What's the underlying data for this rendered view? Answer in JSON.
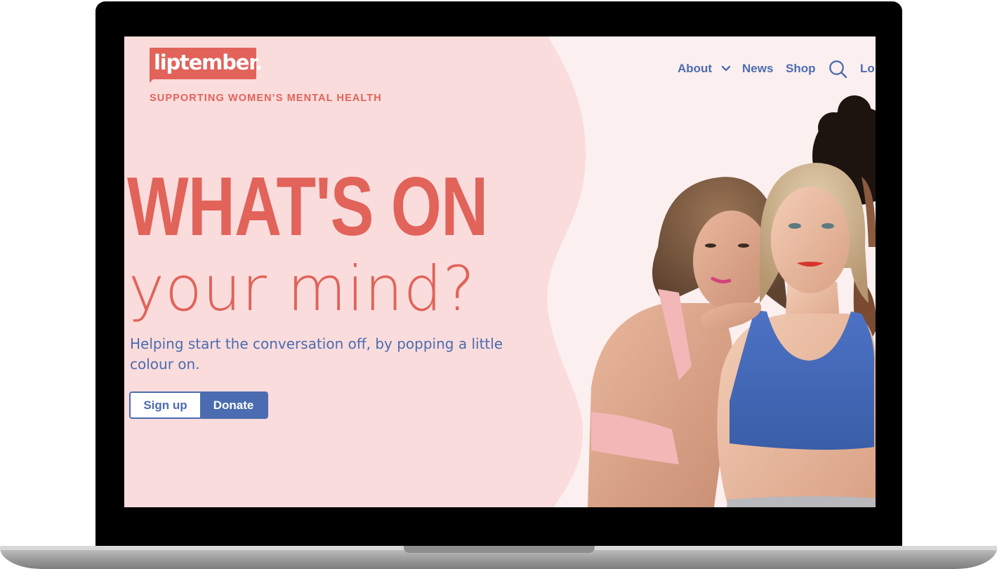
{
  "brand": {
    "logo_text": "liptember.",
    "tagline": "SUPPORTING WOMEN’S MENTAL HEALTH",
    "accent_color": "#e1635a",
    "primary_color": "#4b6cb0",
    "background_color": "#fadcdc"
  },
  "nav": {
    "items": [
      {
        "label": "About",
        "has_dropdown": true
      },
      {
        "label": "News"
      },
      {
        "label": "Shop"
      },
      {
        "label": "Lo"
      }
    ],
    "search_icon": "search-icon",
    "dropdown_icon": "chevron-down-icon"
  },
  "hero": {
    "headline": "WHAT'S ON",
    "subheadline": "your mind?",
    "lede": "Helping start the conversation off, by popping a little colour on.",
    "signup_label": "Sign up",
    "donate_label": "Donate"
  }
}
